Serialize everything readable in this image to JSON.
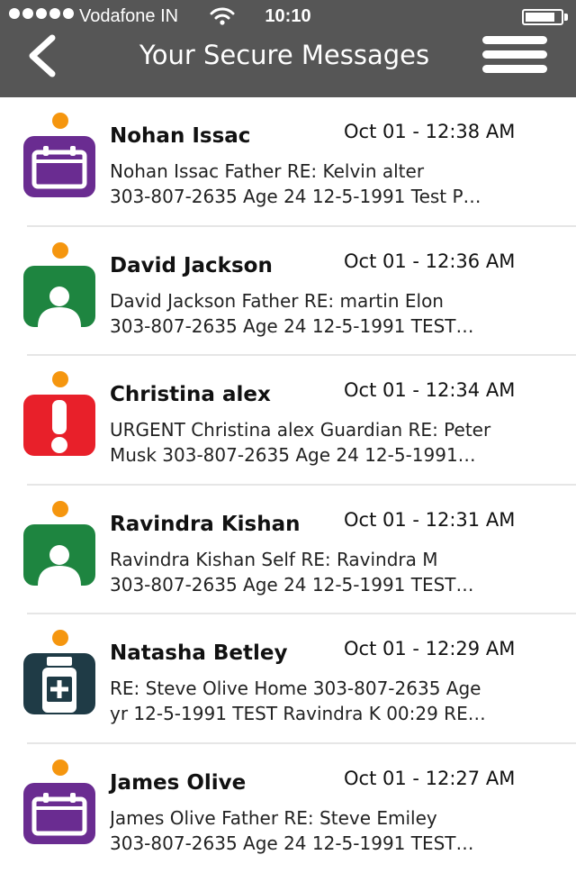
{
  "status_bar": {
    "carrier": "Vodafone IN",
    "time": "10:10"
  },
  "nav": {
    "title": "Your Secure Messages"
  },
  "colors": {
    "header_bg": "#565656",
    "unread_dot": "#f5960f",
    "calendar": "#6a2c91",
    "person": "#1e8540",
    "urgent": "#e8202a",
    "medication": "#1f3b46"
  },
  "messages": [
    {
      "icon": "calendar-icon",
      "name": "Nohan Issac",
      "date": "Oct 01 - 12:38 AM",
      "line1": "Nohan Issac Father RE: Kelvin alter",
      "line2": "303-807-2635 Age 24 12-5-1991 Test P…"
    },
    {
      "icon": "person-icon",
      "name": "David Jackson",
      "date": "Oct 01 - 12:36 AM",
      "line1": "David Jackson Father RE: martin Elon",
      "line2": "303-807-2635 Age 24 12-5-1991 TEST…"
    },
    {
      "icon": "urgent-icon",
      "name": "Christina alex",
      "date": "Oct 01 - 12:34 AM",
      "line1": "URGENT Christina alex Guardian RE: Peter",
      "line2": "Musk 303-807-2635 Age 24 12-5-1991…"
    },
    {
      "icon": "person-icon",
      "name": "Ravindra Kishan",
      "date": "Oct 01 - 12:31 AM",
      "line1": "Ravindra Kishan Self RE: Ravindra M",
      "line2": "303-807-2635 Age 24 12-5-1991 TEST…"
    },
    {
      "icon": "medication-icon",
      "name": "Natasha Betley",
      "date": "Oct 01 - 12:29 AM",
      "line1": "RE: Steve Olive Home 303-807-2635 Age",
      "line2": "yr 12-5-1991 TEST Ravindra K 00:29 RE…"
    },
    {
      "icon": "calendar-icon",
      "name": "James Olive",
      "date": "Oct 01 - 12:27 AM",
      "line1": "James Olive Father RE: Steve Emiley",
      "line2": "303-807-2635 Age 24 12-5-1991 TEST…"
    }
  ]
}
